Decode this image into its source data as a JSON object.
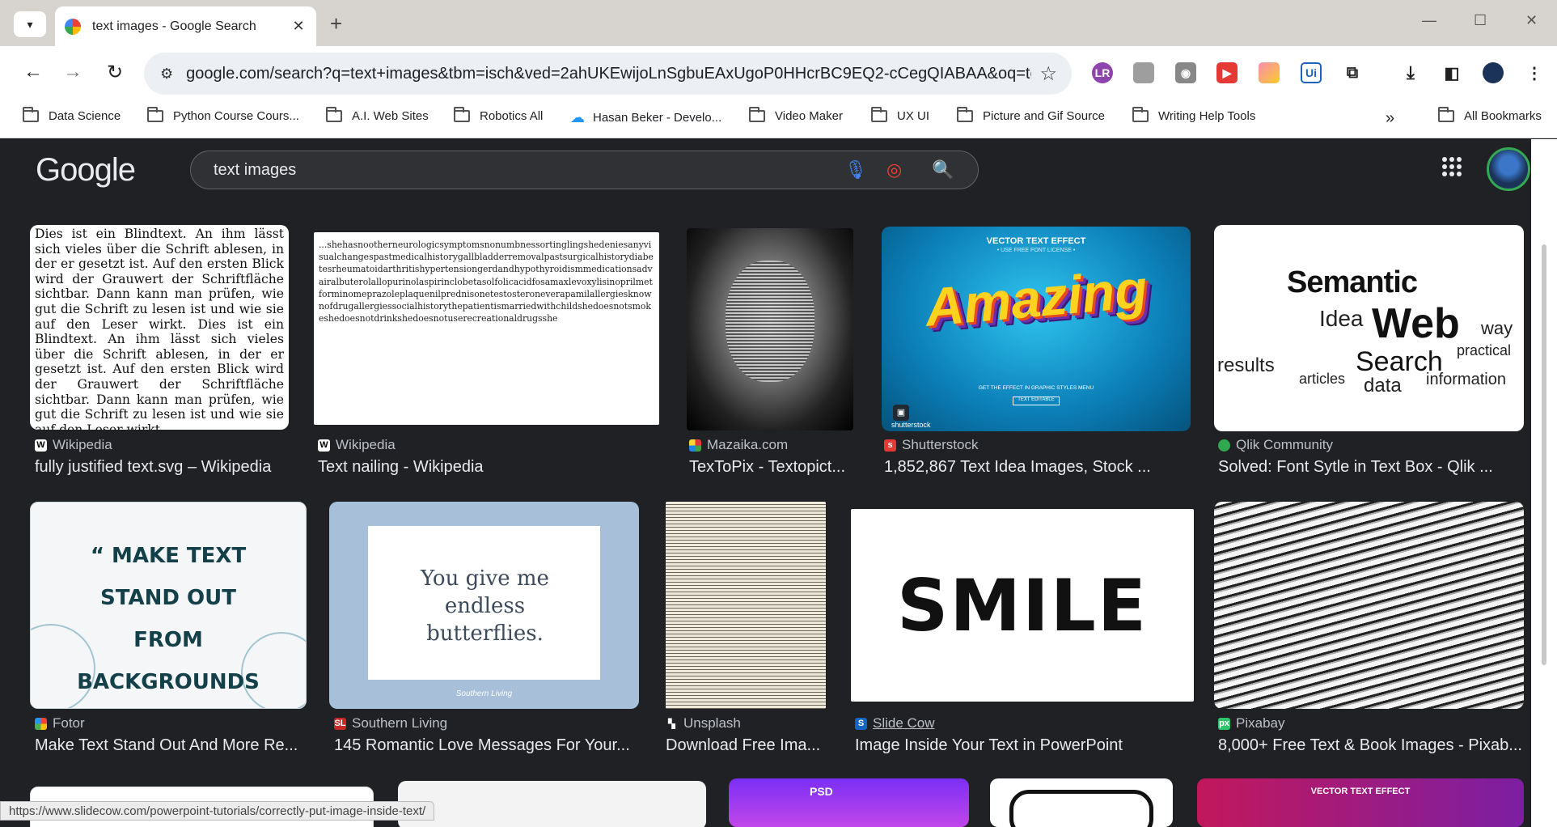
{
  "browser": {
    "tab_title": "text images - Google Search",
    "url": "google.com/search?q=text+images&tbm=isch&ved=2ahUKEwijoLnSgbuEAxUgoP0HHcrBC9EQ2-cCegQIABAA&oq=te...",
    "new_tab": "+",
    "minimize": "—",
    "maximize": "☐",
    "close_window": "✕"
  },
  "bookmarks": [
    "Data Science",
    "Python Course Cours...",
    "A.I. Web Sites",
    "Robotics All",
    "Hasan Beker - Develo...",
    "Video Maker",
    "UX UI",
    "Picture and Gif Source",
    "Writing Help Tools"
  ],
  "all_bookmarks": "All Bookmarks",
  "overflow": "»",
  "google": {
    "logo": "Google",
    "query": "text images"
  },
  "results_row1": [
    {
      "source": "Wikipedia",
      "caption": "fully justified text.svg – Wikipedia"
    },
    {
      "source": "Wikipedia",
      "caption": "Text nailing - Wikipedia"
    },
    {
      "source": "Mazaika.com",
      "caption": "TexToPix - Textopict..."
    },
    {
      "source": "Shutterstock",
      "caption": "1,852,867 Text Idea Images, Stock ..."
    },
    {
      "source": "Qlik Community",
      "caption": "Solved: Font Sytle in Text Box - Qlik ..."
    }
  ],
  "results_row2": [
    {
      "source": "Fotor",
      "caption": "Make Text Stand Out And More Re..."
    },
    {
      "source": "Southern Living",
      "caption": "145 Romantic Love Messages For Your..."
    },
    {
      "source": "Unsplash",
      "caption": "Download Free Ima..."
    },
    {
      "source": "Slide Cow",
      "caption": "Image Inside Your Text in PowerPoint"
    },
    {
      "source": "Pixabay",
      "caption": "8,000+ Free Text & Book Images - Pixab..."
    }
  ],
  "thumb_text": {
    "german": "Dies ist ein Blindtext. An ihm lässt sich vieles über die Schrift ablesen, in der er gesetzt ist. Auf den ersten Blick wird der Grauwert der Schriftfläche sichtbar. Dann kann man prüfen, wie gut die Schrift zu lesen ist und wie sie auf den Leser wirkt. Dies ist ein Blindtext. An ihm lässt sich vieles über die Schrift ablesen, in der er gesetzt ist. Auf den ersten Blick wird der Grauwert der Schriftfläche sichtbar. Dann kann man prüfen, wie gut die Schrift zu lesen ist und wie sie auf den Leser wirkt.",
    "nailing": "...shehasnootherneurologicsymptomsnonumbnessortinglingshedeniesanyvisualchangespastmedicalhistorygallbladderremovalpastsurgicalhistorydiabetesrheumatoidarthritishypertensiongerdandhypothyroidismmedicationsadvairalbuterolallopurinolaspirinclobetasolfolicacidfosamaxlevoxylisinoprilmetforminomeprazoleplaquenilprednisonetestosteroneverapamilallergiesknownofdrugallergiessocialhistorythepatientismarriedwithchildshedoesnotsmokeshedoesnotdrinkshedoesnotuserecreationaldrugsshe",
    "vector_top": "VECTOR TEXT EFFECT",
    "vector_sub": "• USE FREE FONT LICENSE •",
    "amazing": "Amazing",
    "graphic_styles": "GET THE EFFECT IN GRAPHIC STYLES MENU",
    "text_editable": "TEXT EDITABLE",
    "shutterstock": "shutterstock",
    "make_text": "“ MAKE TEXT STAND OUT FROM BACKGROUNDS ”",
    "butterflies": "You give me endless butterflies.",
    "southern": "Southern Living",
    "smile": "SMILE",
    "psd": "PSD",
    "vector_bottom": "VECTOR TEXT EFFECT"
  },
  "status_url": "https://www.slidecow.com/powerpoint-tutorials/correctly-put-image-inside-text/"
}
